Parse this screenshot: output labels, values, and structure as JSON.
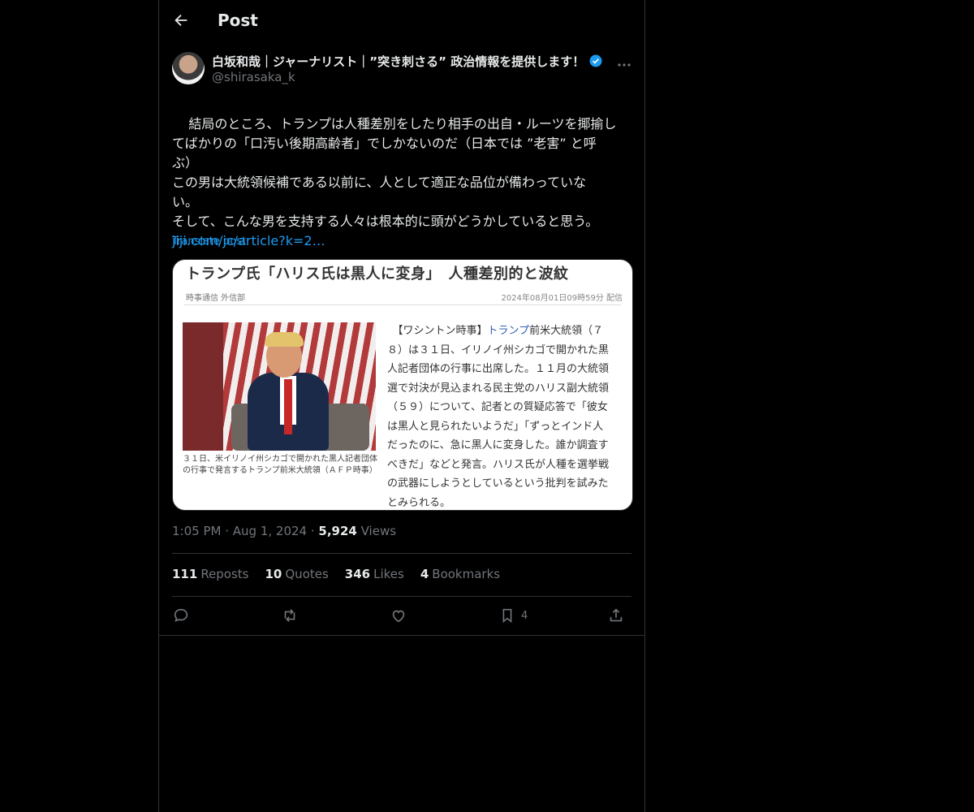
{
  "header": {
    "title": "Post"
  },
  "author": {
    "display_name": "白坂和哉｜ジャーナリスト｜”突き刺さる” 政治情報を提供します！",
    "handle": "@shirasaka_k"
  },
  "tweet": {
    "text": "結局のところ、トランプは人種差別をしたり相手の出自・ルーツを揶揄し\nてばかりの「口汚い後期高齢者」でしかないのだ（日本では ”老害” と呼\nぶ）\nこの男は大統領候補である以前に、人として適正な品位が備わっていな\nい。\nそして、こんな男を支持する人々は根本的に頭がどうかしていると思う。",
    "link": "jiji.com/jc/article?k=2…",
    "translate_label": "Translate post"
  },
  "article": {
    "title": "トランプ氏「ハリス氏は黒人に変身」　人種差別的と波紋",
    "source": "時事通信 外信部",
    "date": "2024年08月01日09時59分 配信",
    "caption": "３１日、米イリノイ州シカゴで開かれた黒人記者団体の行事で発言するトランプ前米大統領（ＡＦＰ時事）",
    "body_prefix": "　【ワシントン時事】",
    "body_highlight": "トランプ",
    "body_rest": "前米大統領（７\n８）は３１日、イリノイ州シカゴで開かれた黒\n人記者団体の行事に出席した。１１月の大統領\n選で対決が見込まれる民主党のハリス副大統領\n（５９）について、記者との質疑応答で「彼女\nは黒人と見られたいようだ」「ずっとインド人\nだったのに、急に黒人に変身した。誰か調査す\nべきだ」などと発言。ハリス氏が人種を選挙戦\nの武器にしようとしているという批判を試みた\nとみられる。"
  },
  "meta": {
    "time": "1:05 PM",
    "date": "Aug 1, 2024",
    "views_count": "5,924",
    "views_label": "Views"
  },
  "stats": {
    "reposts_count": "111",
    "reposts_label": "Reposts",
    "quotes_count": "10",
    "quotes_label": "Quotes",
    "likes_count": "346",
    "likes_label": "Likes",
    "bookmarks_count": "4",
    "bookmarks_label": "Bookmarks"
  },
  "actions": {
    "bookmark_count": "4"
  },
  "icons": [
    "back-arrow-icon",
    "verified-badge-icon",
    "more-options-icon",
    "reply-icon",
    "repost-icon",
    "like-icon",
    "bookmark-icon",
    "share-icon"
  ],
  "colors": {
    "background": "#000000",
    "text": "#e7e9ea",
    "muted": "#71767b",
    "accent": "#1d9bf0"
  }
}
